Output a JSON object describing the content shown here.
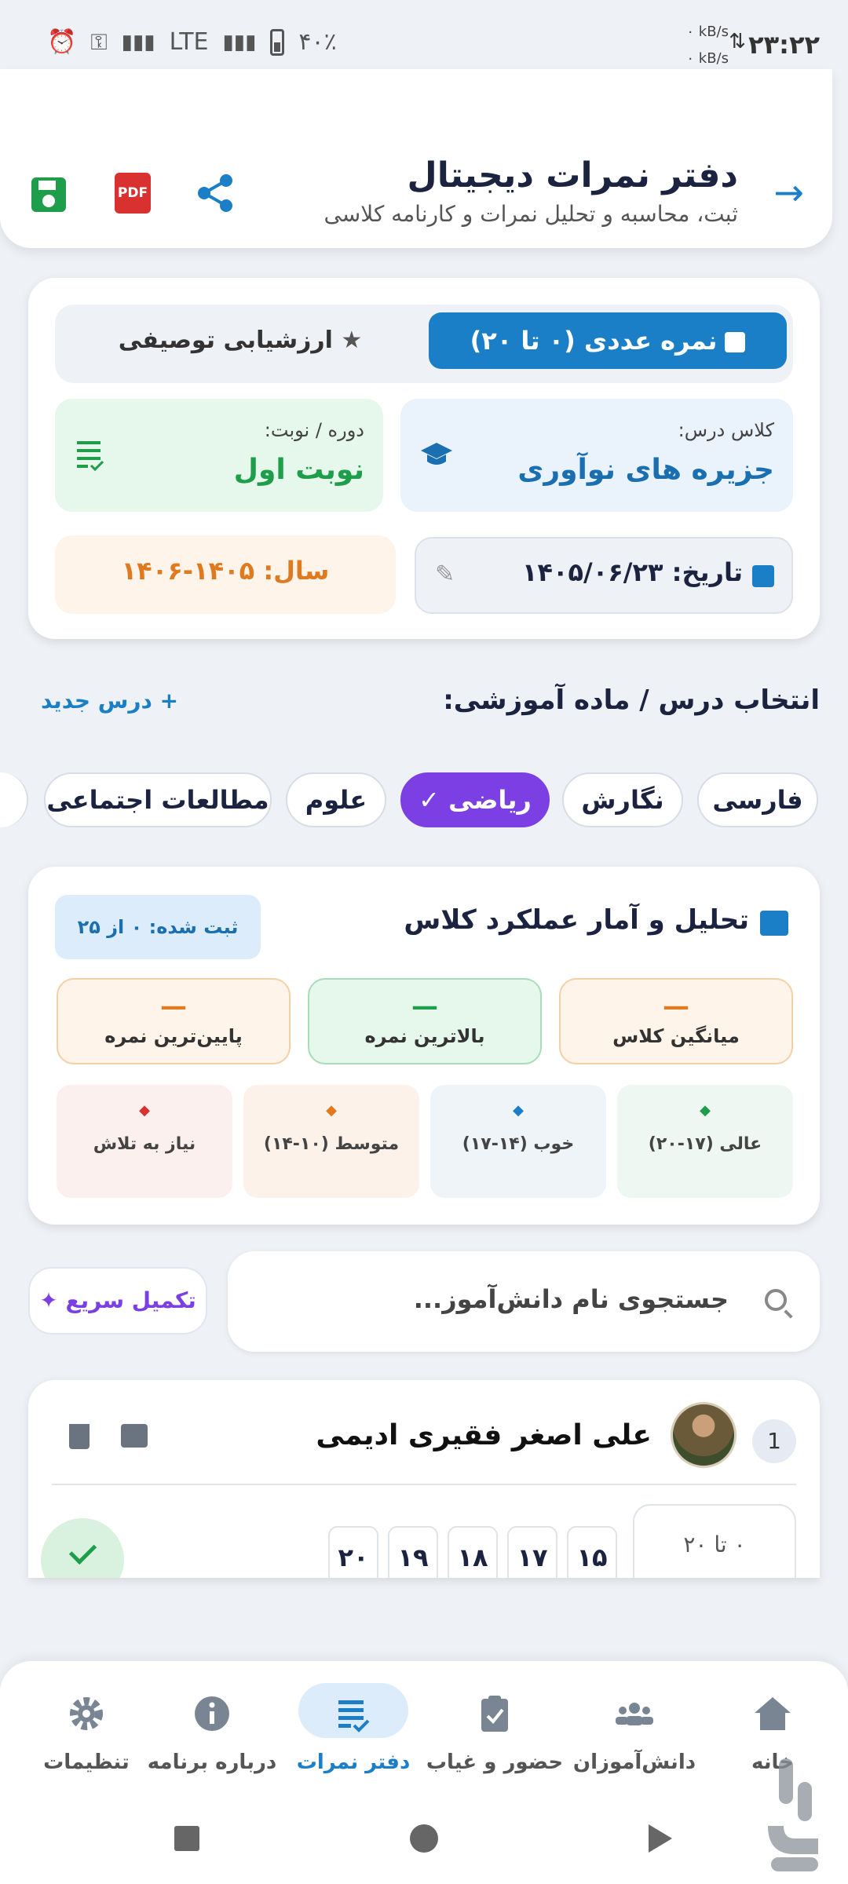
{
  "status_bar": {
    "time": "۲۳:۲۲",
    "speed_up": "۰ kB/s",
    "speed_down": "۰ kB/s",
    "network": "LTE",
    "battery": "۴۰٪"
  },
  "header": {
    "title": "دفتر نمرات دیجیتال",
    "subtitle": "ثبت، محاسبه و تحلیل نمرات و کارنامه کلاسی",
    "pdf_label": "PDF"
  },
  "mode_toggle": {
    "numeric": "نمره عددی (۰ تا ۲۰)",
    "descriptive": "ارزشیابی توصیفی",
    "active": "numeric"
  },
  "class_info": {
    "class_label": "کلاس درس:",
    "class_value": "جزیره های نوآوری",
    "term_label": "دوره / نوبت:",
    "term_value": "نوبت اول",
    "date_text": "تاریخ: ۱۴۰۵/۰۶/۲۳",
    "year_text": "سال: ۱۴۰۵-۱۴۰۶"
  },
  "subjects": {
    "section_title": "انتخاب درس / ماده آموزشی:",
    "new_lesson": "+ درس جدید",
    "items": [
      "فارسی",
      "نگارش",
      "ریاضی",
      "علوم",
      "مطالعات اجتماعی"
    ],
    "active": "ریاضی"
  },
  "stats": {
    "title": "تحلیل و آمار عملکرد کلاس",
    "recorded": "ثبت شده: ۰ از ۲۵ (۰٪)",
    "average_label": "میانگین کلاس",
    "average_value": "—",
    "max_label": "بالاترین نمره",
    "max_value": "—",
    "min_label": "پایین‌ترین نمره",
    "min_value": "—",
    "grades": [
      {
        "label": "عالی (۱۷-۲۰)",
        "color": "#1e9e4a"
      },
      {
        "label": "خوب (۱۴-۱۷)",
        "color": "#1a7fc6"
      },
      {
        "label": "متوسط (۱۰-۱۴)",
        "color": "#e07a1f"
      },
      {
        "label": "نیاز به تلاش",
        "color": "#d93030"
      }
    ]
  },
  "search": {
    "placeholder": "جستجوی نام دانش‌آموز...",
    "quick_fill": "تکمیل سریع"
  },
  "student": {
    "index": "1",
    "name": "علی اصغر فقیری ادیمی",
    "range": "۰ تا ۲۰",
    "quick_scores": [
      "۲۰",
      "۱۹",
      "۱۸",
      "۱۷",
      "۱۵"
    ]
  },
  "bottom_nav": {
    "items": [
      "خانه",
      "دانش‌آموزان",
      "حضور و غیاب",
      "دفتر نمرات",
      "درباره برنامه",
      "تنظیمات"
    ],
    "active": "دفتر نمرات"
  },
  "colors": {
    "primary": "#1a7fc6",
    "accent": "#7b3fe4",
    "success": "#1e9e4a",
    "warning": "#e07a1f",
    "danger": "#d93030"
  }
}
